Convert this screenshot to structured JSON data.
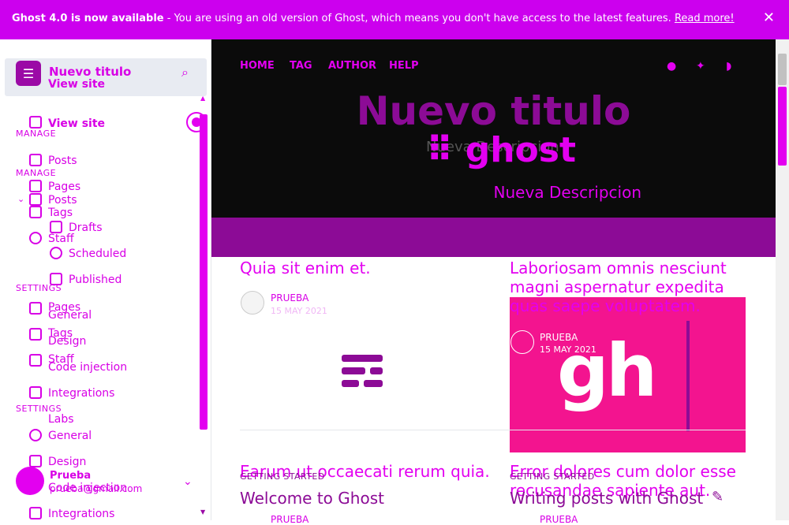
{
  "banner": {
    "bold_text": "Ghost 4.0 is now available",
    "text": " - You are using an old version of Ghost, which means you don't have access to the latest features. ",
    "link": "Read more!",
    "close": "✕"
  },
  "sidebar": {
    "site_name": "Nuevo titulo",
    "site_name_ghost": "Nuevo titulo",
    "view_site": "View site",
    "view_site_2": "View site",
    "manage_heading": "MANAGE",
    "manage_heading_2": "MANAGE",
    "settings_heading": "SETTINGS",
    "settings_heading_2": "SETTINGS",
    "items": {
      "posts": "Posts",
      "posts_2": "Posts",
      "pages": "Pages",
      "pages_2": "Pages",
      "tags": "Tags",
      "tags_2": "Tags",
      "staff": "Staff",
      "staff_2": "Staff",
      "drafts": "Drafts",
      "scheduled": "Scheduled",
      "published": "Published",
      "general": "General",
      "general_2": "General",
      "design": "Design",
      "design_2": "Design",
      "code_injection": "Code injection",
      "code_injection_2": "Code injection",
      "integrations": "Integrations",
      "integrations_2": "Integrations",
      "labs": "Labs"
    },
    "user_name": "Prueba",
    "user_email": "prueba@gmail.com"
  },
  "site": {
    "nav": [
      "HOME",
      "TAG",
      "AUTHOR",
      "HELP"
    ],
    "title": "Nuevo titulo",
    "ghost_logo_text": "ghost",
    "description": "Nueva Descripcion",
    "description_ghost": "Nueva Descripcion"
  },
  "posts": [
    {
      "title": "Quia sit enim et.",
      "author": "PRUEBA",
      "date": "15 MAY 2021"
    },
    {
      "title": "Laboriosam omnis nesciunt magni aspernatur expedita quas saepe voluptatem.",
      "author": "PRUEBA",
      "date": "15 MAY 2021",
      "image_text": "gh"
    },
    {
      "title": "Earum ut occaecati rerum quia.",
      "tag": "GETTING STARTED",
      "title_2": "Welcome to Ghost",
      "author": "PRUEBA"
    },
    {
      "title": "Error dolores cum dolor esse recusandae sapiente aut.",
      "tag": "GETTING STARTED",
      "title_2": "Writing posts with Ghost",
      "author": "PRUEBA"
    }
  ],
  "colors": {
    "accent": "#e300f0",
    "dark_accent": "#8c0b96",
    "hero_bg": "#0b0b0b"
  }
}
